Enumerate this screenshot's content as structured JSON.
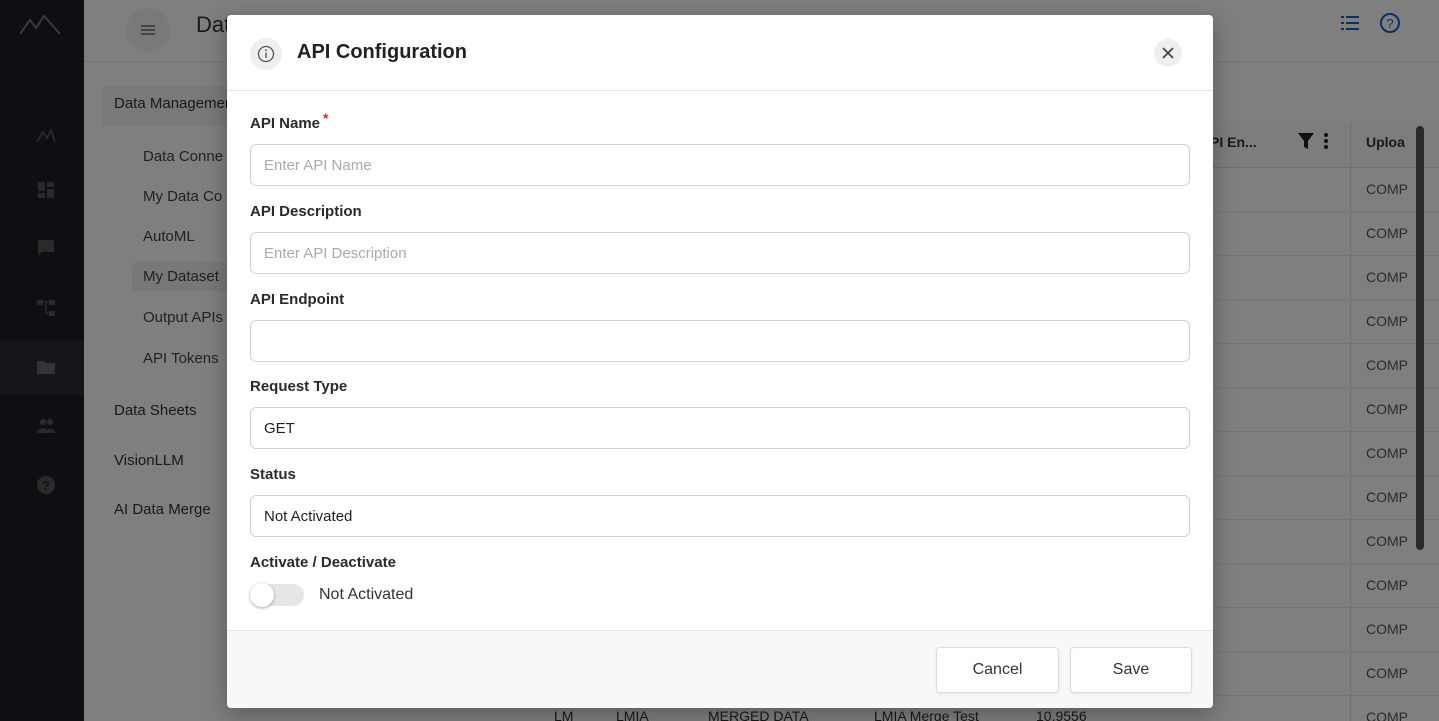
{
  "background": {
    "app_title": "Dat",
    "subnav": {
      "group_head": "Data Management",
      "items": [
        "Data Conne",
        "My Data Co",
        "AutoML",
        "My Dataset",
        "Output APIs",
        "API Tokens"
      ],
      "top_items": [
        "Data Sheets",
        "VisionLLM",
        "AI Data Merge"
      ]
    },
    "grid": {
      "header_col1": "PI En...",
      "header_col2": "Uploa",
      "cells": [
        "COMP",
        "COMP",
        "COMP",
        "COMP",
        "COMP",
        "COMP",
        "COMP",
        "COMP",
        "COMP",
        "COMP",
        "COMP",
        "COMP",
        "COMP"
      ]
    },
    "bottom_row": [
      "LM",
      "LMIA",
      "MERGED DATA",
      "LMIA Merge Test",
      "10.9556"
    ]
  },
  "modal": {
    "title": "API Configuration",
    "fields": {
      "api_name": {
        "label": "API Name",
        "required_mark": "*",
        "placeholder": "Enter API Name",
        "value": ""
      },
      "api_description": {
        "label": "API Description",
        "placeholder": "Enter API Description",
        "value": ""
      },
      "api_endpoint": {
        "label": "API Endpoint",
        "value": ""
      },
      "request_type": {
        "label": "Request Type",
        "value": "GET"
      },
      "status": {
        "label": "Status",
        "value": "Not Activated"
      }
    },
    "toggle": {
      "label": "Activate / Deactivate",
      "state_text": "Not Activated",
      "on": false
    },
    "buttons": {
      "cancel": "Cancel",
      "save": "Save"
    }
  }
}
